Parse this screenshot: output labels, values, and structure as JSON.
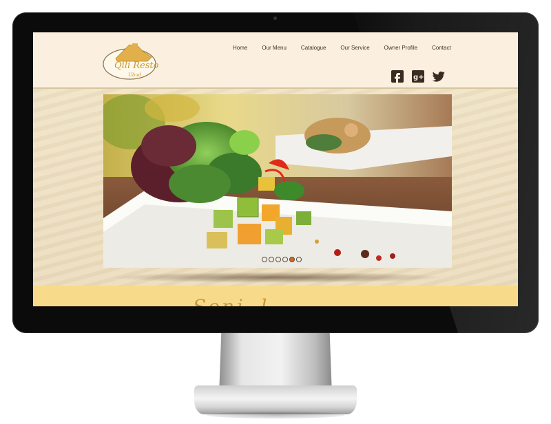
{
  "site": {
    "logo": {
      "main": "Qili Resto",
      "sub": "Ubud"
    },
    "nav": [
      "Home",
      "Our Menu",
      "Catalogue",
      "Our Service",
      "Owner Profile",
      "Contact"
    ],
    "social": [
      {
        "name": "facebook-icon",
        "glyph": "f"
      },
      {
        "name": "google-plus-icon",
        "glyph": "g+"
      },
      {
        "name": "twitter-icon",
        "glyph": "twitter"
      }
    ],
    "slider": {
      "total": 6,
      "active_index": 4
    },
    "band_script": "Sonj..l..."
  },
  "colors": {
    "header_bg": "#fbf0df",
    "nav_text": "#3b3327",
    "accent": "#d46a2a",
    "band": "#f8db8a",
    "logo_gold": "#e2b04a"
  }
}
